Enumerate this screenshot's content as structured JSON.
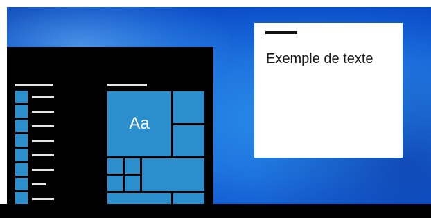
{
  "tiles": {
    "primary_label": "Aa"
  },
  "text_window": {
    "sample_text": "Exemple de texte"
  },
  "colors": {
    "desktop_blue": "#1e74df",
    "accent_tile": "#2b8fce",
    "menu_background": "#000000",
    "placeholder_bar": "#e6e6e6",
    "taskbar": "#000000"
  }
}
